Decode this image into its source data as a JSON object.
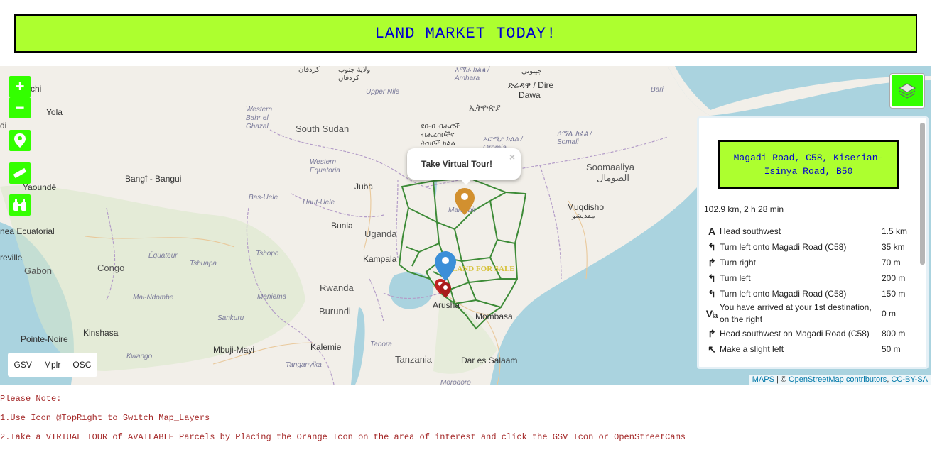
{
  "header": {
    "title": "LAND MARKET TODAY!"
  },
  "map": {
    "labels": {
      "south_sudan": "South Sudan",
      "uganda": "Uganda",
      "rwanda": "Rwanda",
      "burundi": "Burundi",
      "congo": "Congo",
      "gabon": "Gabon",
      "tanzania": "Tanzania",
      "somaaliya": "Soomaaliya",
      "somaaliya_ar": "الصومال",
      "juba": "Juba",
      "bangui": "Bangî - Bangui",
      "yaounde": "Yaoundé",
      "bunia": "Bunia",
      "kampala": "Kampala",
      "kinshasa": "Kinshasa",
      "kalemie": "Kalemie",
      "mbuji_mayi": "Mbuji-Mayi",
      "pointe_noire": "Pointe-Noire",
      "arusha": "Arusha",
      "mombasa": "Mombasa",
      "dar": "Dar es Salaam",
      "mogadishu": "Muqdisho",
      "mogadishu_ar": "مقديشو",
      "dire_dawa": "ድሬዳዋ / Dire",
      "dire_dawa2": "Dawa",
      "ethiopia": "ኢትዮጵያ",
      "bari": "Bari",
      "yola": "Yola",
      "chi": "chi",
      "di": "di",
      "eville": "reville",
      "nea_ecuatorial": "nea Ecuatorial",
      "marsabit": "Marsabit",
      "upper_nile": "Upper Nile",
      "w_bahr": "Western Bahr el Ghazal",
      "w_equatoria": "Western Equatoria",
      "bas_uele": "Bas-Uele",
      "haut_uele": "Haut-Uele",
      "tshopo": "Tshopo",
      "equateur": "Équateur",
      "tshuapa": "Tshuapa",
      "maniema": "Maniema",
      "mai_ndombe": "Mai-Ndombe",
      "sankuru": "Sankuru",
      "kwango": "Kwango",
      "tanganyika": "Tanganyika",
      "tabora": "Tabora",
      "morogoro": "Morogoro",
      "somali": "ሶማሌ ክልል / Somali",
      "amhara": "አማራ ክልል / Amhara",
      "oromia": "ኦሮሚያ ክልል / Oromia",
      "snnpr": "ደቡብ ብሔሮች ብሔረሰቦችና ሕዝቦች ክልል",
      "jibuti": "جيبوتي",
      "kordofan": "كردفان",
      "south_kordofan": "ولاية جنوب كردفان"
    },
    "land_for_sale": "LAND FOR SALE",
    "popup": {
      "text": "Take Virtual Tour!",
      "close": "×"
    },
    "street_switch": [
      "GSV",
      "Mplr",
      "OSC"
    ],
    "attribution": {
      "maps": "MAPS",
      "sep": " | © ",
      "osm": "OpenStreetMap contributors",
      "license": "CC-BY-SA"
    }
  },
  "controls": {
    "zoom_in": "+",
    "zoom_out": "−"
  },
  "route": {
    "title": "Magadi Road, C58, Kiserian-Isinya Road, B50",
    "summary": "102.9 km, 2 h 28 min",
    "steps": [
      {
        "icon": "A",
        "text": "Head southwest",
        "distance": "1.5 km"
      },
      {
        "icon": "↰",
        "text": "Turn left onto Magadi Road (C58)",
        "distance": "35 km"
      },
      {
        "icon": "↱",
        "text": "Turn right",
        "distance": "70 m"
      },
      {
        "icon": "↰",
        "text": "Turn left",
        "distance": "200 m"
      },
      {
        "icon": "↰",
        "text": "Turn left onto Magadi Road (C58)",
        "distance": "150 m"
      },
      {
        "icon": "Vᵢₐ",
        "text": "You have arrived at your 1st destination, on the right",
        "distance": "0 m"
      },
      {
        "icon": "↱",
        "text": "Head southwest on Magadi Road (C58)",
        "distance": "800 m"
      },
      {
        "icon": "↖",
        "text": "Make a slight left",
        "distance": "50 m"
      }
    ]
  },
  "notes": {
    "heading": "Please Note:",
    "line1": "1.Use Icon @TopRight to Switch Map_Layers",
    "line2": "2.Take a VIRTUAL TOUR of AVAILABLE Parcels by Placing the Orange Icon on the area of interest and click the GSV Icon or OpenStreetCams"
  }
}
